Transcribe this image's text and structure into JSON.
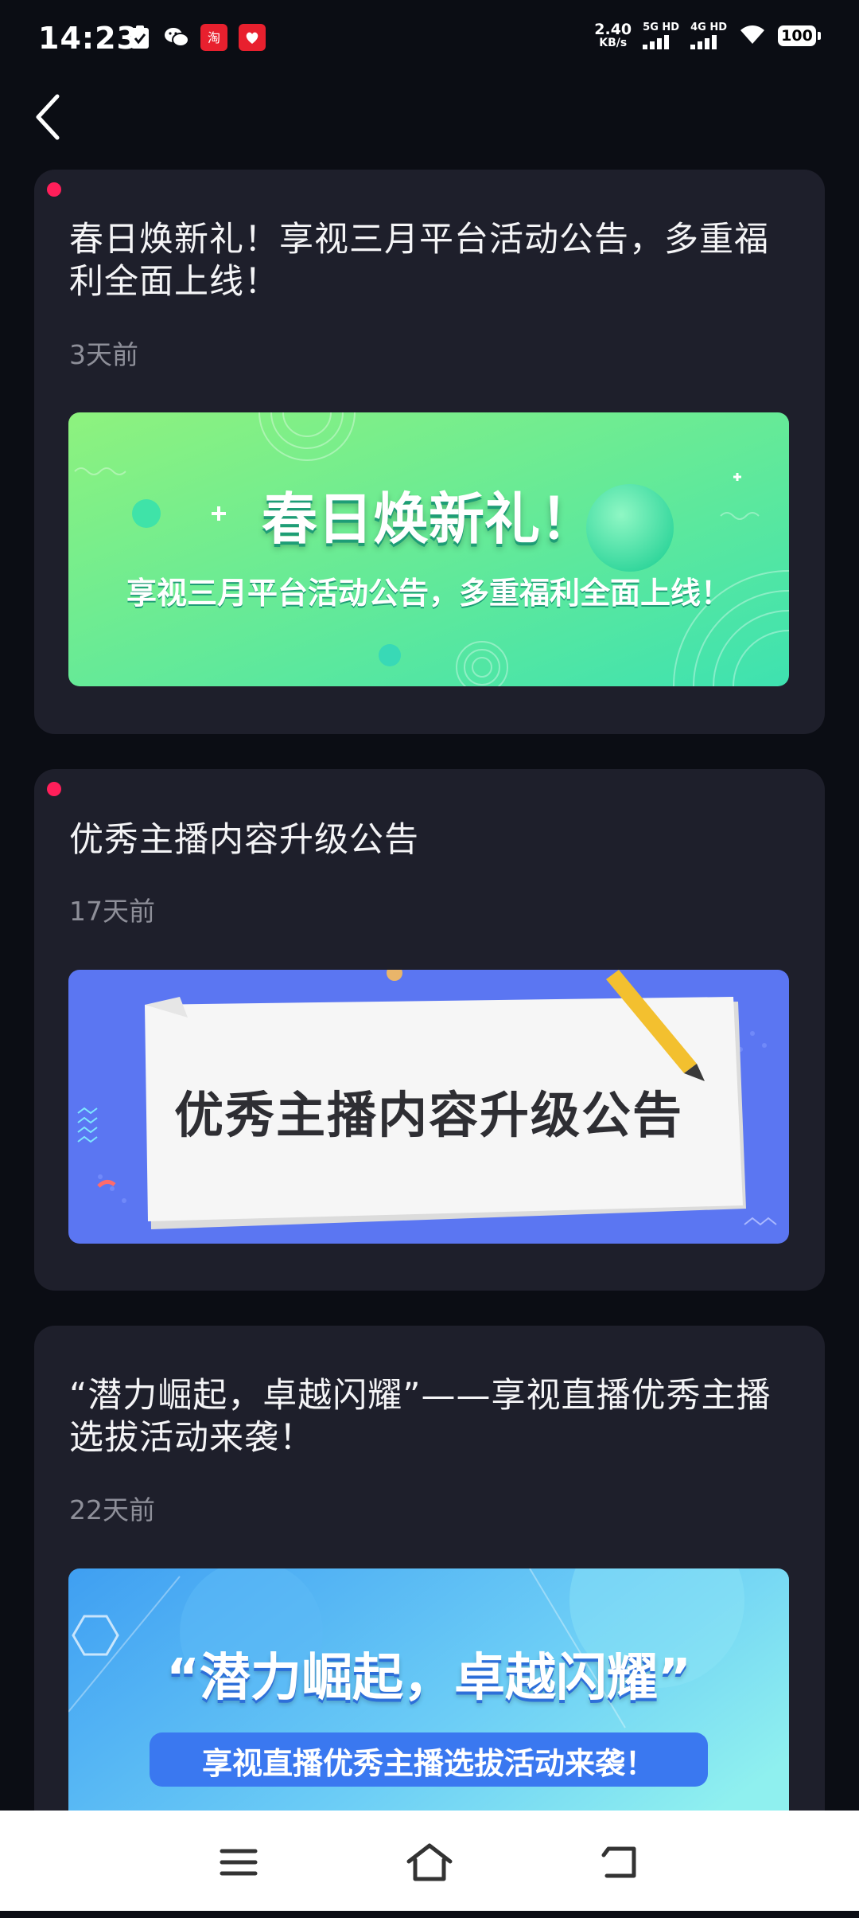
{
  "status_bar": {
    "time": "14:23",
    "net_speed_value": "2.40",
    "net_speed_unit": "KB/s",
    "sim1_label": "5G HD",
    "sim2_label": "4G HD",
    "battery_level": "100",
    "icons": [
      "checkmark-clipboard-icon",
      "wechat-icon",
      "taobao-icon",
      "app-red-icon",
      "wifi-icon"
    ]
  },
  "header": {
    "back_icon": "chevron-left-icon"
  },
  "announcements": [
    {
      "title": "春日焕新礼！享视三月平台活动公告，多重福利全面上线！",
      "time": "3天前",
      "unread": true,
      "banner": {
        "headline": "春日焕新礼！",
        "subline": "享视三月平台活动公告，多重福利全面上线！",
        "colors": [
          "#8ef27e",
          "#3ee2b0"
        ]
      }
    },
    {
      "title": "优秀主播内容升级公告",
      "time": "17天前",
      "unread": true,
      "banner": {
        "headline": "优秀主播内容升级公告",
        "colors": [
          "#5b76f2",
          "#f6f6f6"
        ]
      }
    },
    {
      "title": "“潜力崛起，卓越闪耀”——享视直播优秀主播选拔活动来袭！",
      "time": "22天前",
      "unread": false,
      "banner": {
        "headline": "“潜力崛起，卓越闪耀”",
        "subline": "享视直播优秀主播选拔活动来袭！",
        "colors": [
          "#4aa8f4",
          "#7ee8f2"
        ]
      }
    }
  ],
  "nav_bar": {
    "icons": [
      "menu-icon",
      "home-icon",
      "back-icon"
    ]
  },
  "colors": {
    "background": "#0b0d14",
    "card": "#1e1f2b",
    "unread_dot": "#ff1f5a",
    "time_text": "#8e8f99"
  }
}
